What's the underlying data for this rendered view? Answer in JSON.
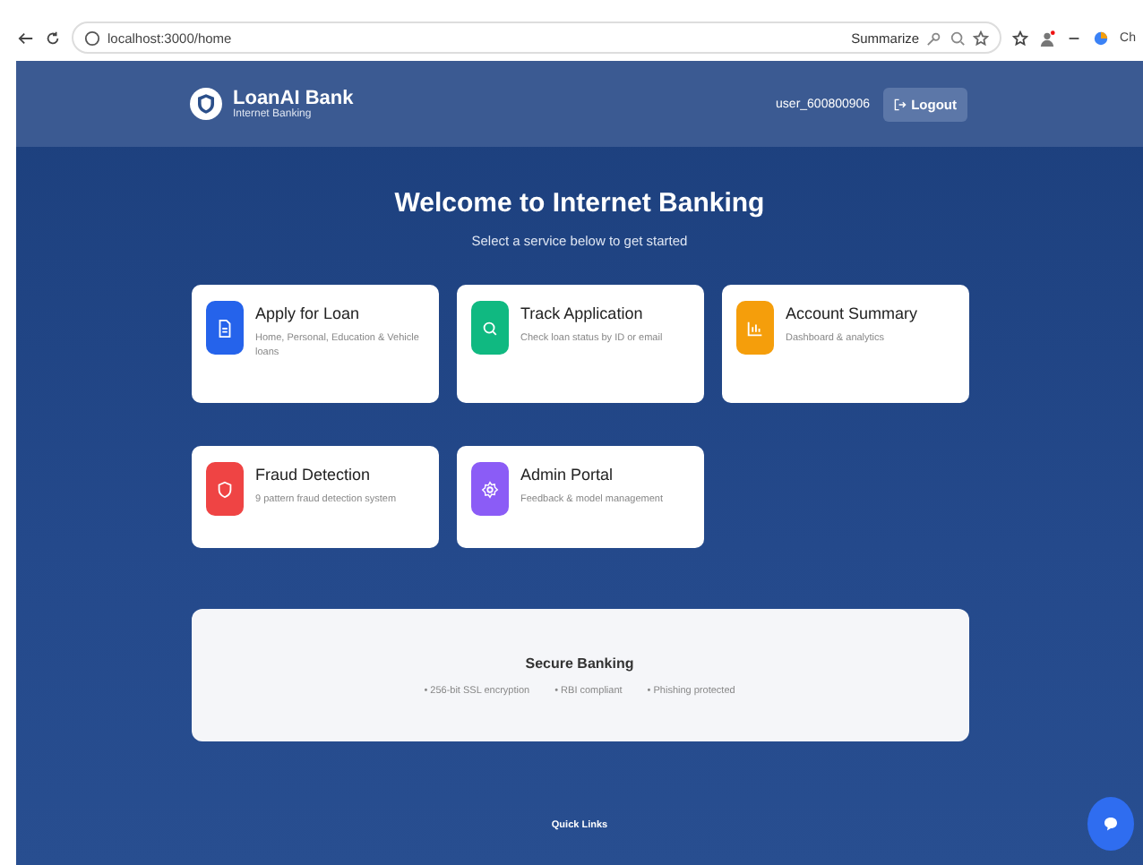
{
  "browser": {
    "url": "localhost:3000/home",
    "summarize": "Summarize",
    "profile_label": "Ch"
  },
  "header": {
    "brand": "LoanAI Bank",
    "tagline": "Internet Banking",
    "user": "user_600800906",
    "logout": "Logout"
  },
  "hero": {
    "title": "Welcome to Internet Banking",
    "subtitle": "Select a service below to get started"
  },
  "services": [
    {
      "kind": "document",
      "title": "Apply for Loan",
      "description": "Home, Personal, Education & Vehicle loans",
      "color": "#2563eb"
    },
    {
      "kind": "search",
      "title": "Track Application",
      "description": "Check loan status by ID or email",
      "color": "#10b981"
    },
    {
      "kind": "chart",
      "title": "Account Summary",
      "description": "Dashboard & analytics",
      "color": "#f59e0b"
    },
    {
      "kind": "shield",
      "title": "Fraud Detection",
      "description": "9 pattern fraud detection system",
      "color": "#ef4444"
    },
    {
      "kind": "gear",
      "title": "Admin Portal",
      "description": "Feedback & model management",
      "color": "#8b5cf6"
    }
  ],
  "security": {
    "title": "Secure Banking",
    "features": [
      "• 256-bit SSL encryption",
      "• RBI compliant",
      "• Phishing protected"
    ]
  },
  "footer": {
    "heading": "Quick Links"
  }
}
